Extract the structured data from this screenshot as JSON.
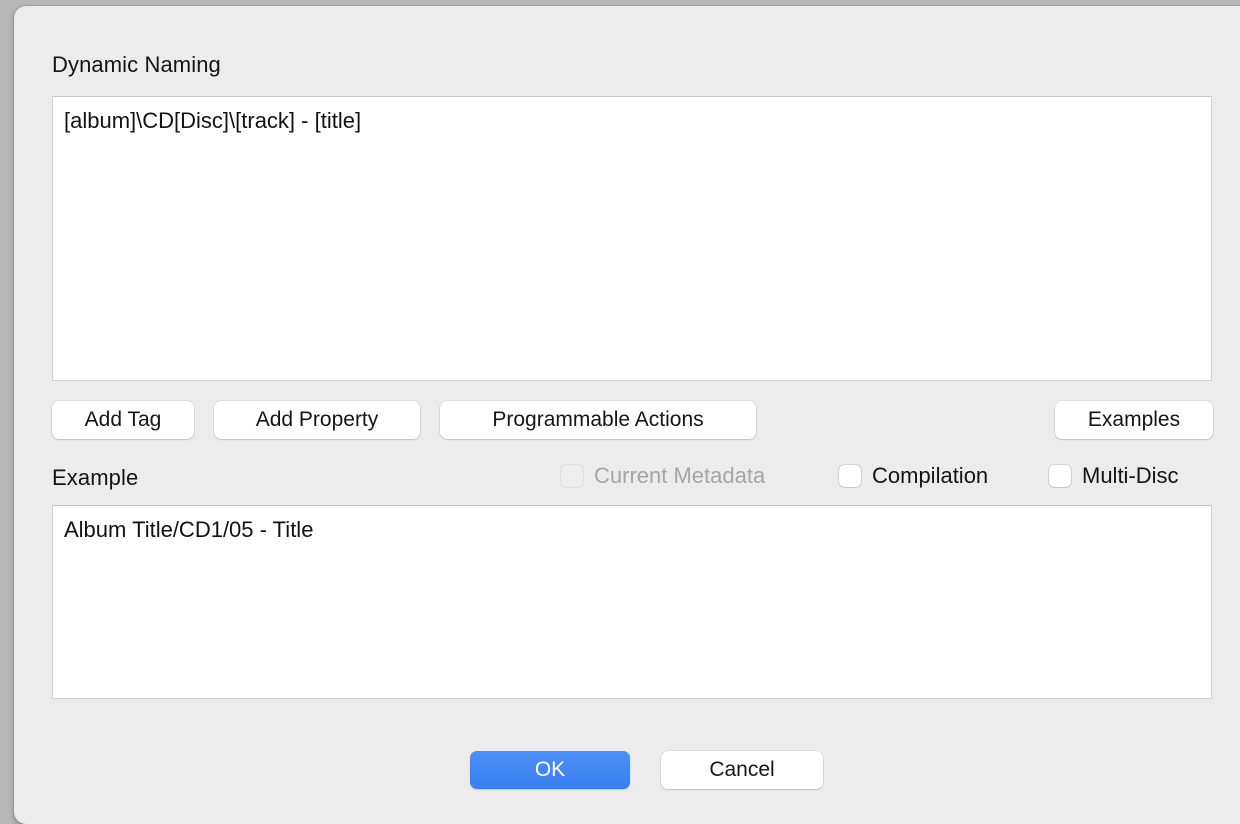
{
  "window": {
    "title": "Dynamic Naming"
  },
  "naming_section": {
    "heading": "Dynamic Naming",
    "pattern_value": "[album]\\CD[Disc]\\[track] - [title]",
    "pattern_placeholder": ""
  },
  "toolbar": {
    "add_tag_label": "Add Tag",
    "add_property_label": "Add Property",
    "programmable_actions_label": "Programmable Actions",
    "examples_label": "Examples"
  },
  "example_section": {
    "heading": "Example",
    "output_value": "Album Title/CD1/05 - Title",
    "checkboxes": [
      {
        "label": "Current Metadata",
        "checked": false,
        "disabled": true
      },
      {
        "label": "Compilation",
        "checked": false,
        "disabled": false
      },
      {
        "label": "Multi-Disc",
        "checked": false,
        "disabled": false
      }
    ]
  },
  "actions": {
    "ok_label": "OK",
    "cancel_label": "Cancel"
  },
  "colors": {
    "dialog_background": "#ececec",
    "desktop_background": "#b8b8b8",
    "field_background": "#ffffff",
    "default_button_blue": "#3f85f5",
    "text_primary": "#141414",
    "text_disabled": "#a6a6a6"
  }
}
